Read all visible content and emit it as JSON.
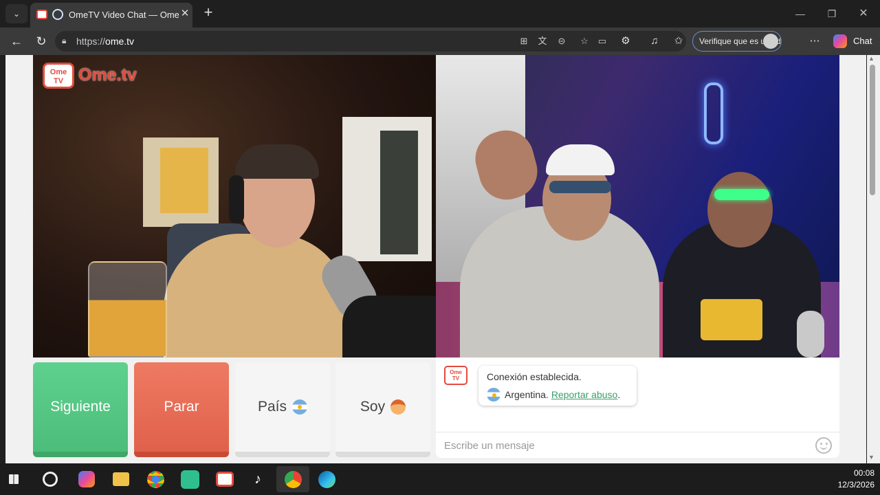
{
  "browser": {
    "tab_title": "OmeTV Video Chat — Omegle",
    "url_prefix": "https://",
    "url_domain": "ome.tv",
    "profile_label": "Verifique que es usted",
    "chat_label": "Chat",
    "new_tab_symbol": "+",
    "close_symbol": "✕"
  },
  "logo": {
    "badge": "Ome TV",
    "word": "Ome.tv"
  },
  "controls": {
    "next_label": "Siguiente",
    "stop_label": "Parar",
    "country_label": "País",
    "gender_label": "Soy"
  },
  "chat": {
    "logo_badge": "Ome TV",
    "status": "Conexión establecida.",
    "country": "Argentina.",
    "report_link": "Reportar abuso",
    "report_suffix": ".",
    "input_placeholder": "Escribe un mensaje"
  },
  "taskbar": {
    "time": "00:08",
    "date": "12/3/2026",
    "icons": [
      "windows-start-icon",
      "search-icon",
      "copilot-icon",
      "file-explorer-icon",
      "chrome-icon",
      "app-icon",
      "ometv-icon",
      "tiktok-icon",
      "chrome-profile-icon",
      "edge-icon"
    ]
  },
  "colors": {
    "next": "#4cbd7a",
    "stop": "#e0614b",
    "brand": "#e14b3d",
    "link": "#3a9d6a"
  }
}
